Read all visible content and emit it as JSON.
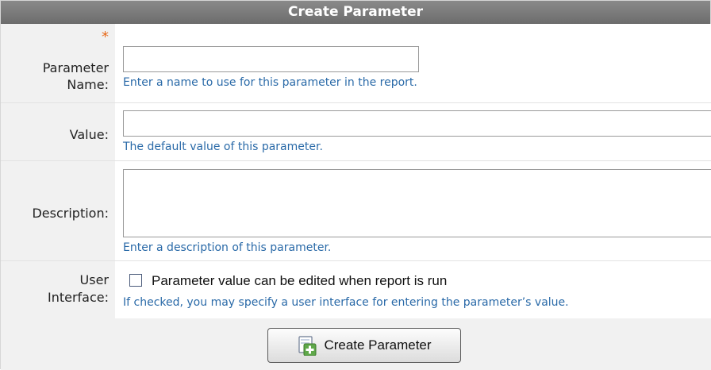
{
  "form": {
    "title": "Create Parameter",
    "required_marker": "*",
    "fields": {
      "parameter_name": {
        "label_line1": "Parameter",
        "label_line2": "Name:",
        "value": "",
        "hint": "Enter a name to use for this parameter in the report."
      },
      "value": {
        "label": "Value:",
        "value": "",
        "hint": "The default value of this parameter."
      },
      "description": {
        "label": "Description:",
        "value": "",
        "hint": "Enter a description of this parameter."
      },
      "user_interface": {
        "label_line1": "User",
        "label_line2": "Interface:",
        "checkbox_label": "Parameter value can be edited when report is run",
        "checked": false,
        "hint": "If checked, you may specify a user interface for entering the parameter’s value."
      }
    },
    "submit_label": "Create Parameter",
    "colors": {
      "header_bg": "#7b7b7b",
      "hint_text": "#2a6aa8",
      "required": "#e76a1a",
      "label_bg": "#f1f1f1"
    }
  }
}
